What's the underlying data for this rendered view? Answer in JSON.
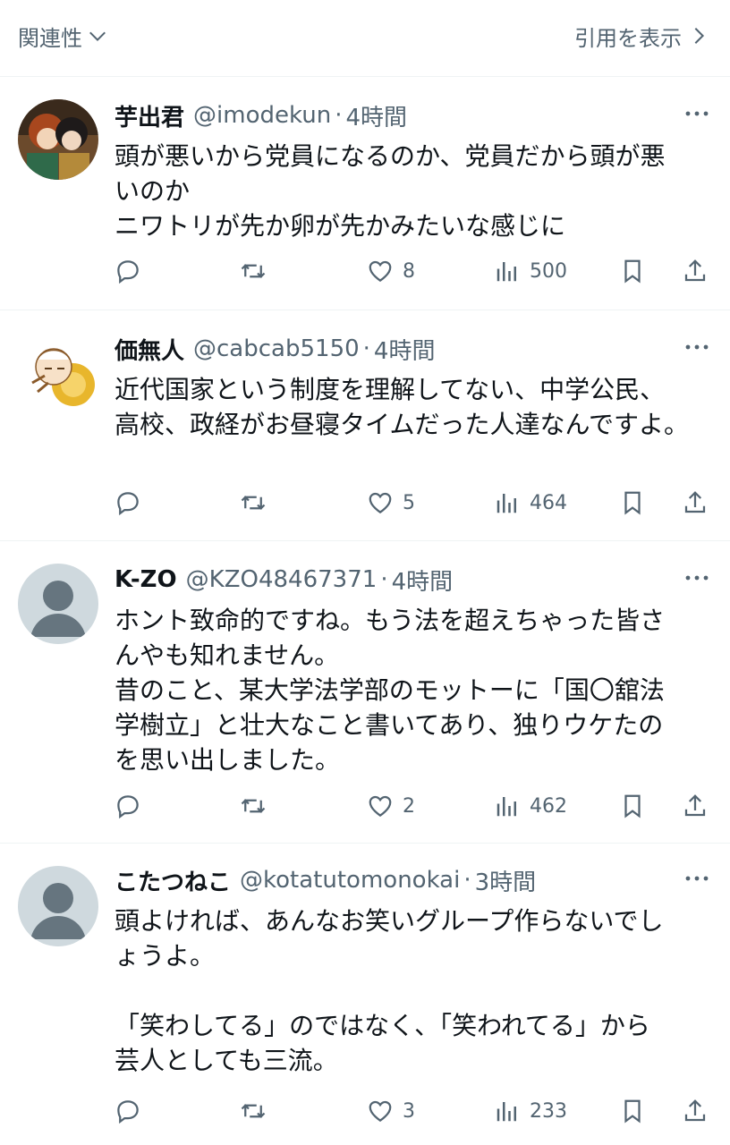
{
  "topbar": {
    "sort_label": "関連性",
    "sort_icon": "chevron-down-icon",
    "quotes_label": "引用を表示",
    "quotes_icon": "chevron-right-icon"
  },
  "tweets": [
    {
      "name": "芋出君",
      "handle": "@imodekun",
      "time": "4時間",
      "text": "頭が悪いから党員になるのか、党員だから頭が悪\nいのか\nニワトリが先か卵が先かみたいな感じに",
      "likes": "8",
      "views": "500"
    },
    {
      "name": "価無人",
      "handle": "@cabcab5150",
      "time": "4時間",
      "text": "近代国家という制度を理解してない、中学公民、\n高校、政経がお昼寝タイムだった人達なんですよ。",
      "likes": "5",
      "views": "464"
    },
    {
      "name": "K-ZO",
      "handle": "@KZO48467371",
      "time": "4時間",
      "text": "ホント致命的ですね。もう法を超えちゃった皆さ\nんやも知れません。\n昔のこと、某大学法学部のモットーに「国〇舘法\n学樹立」と壮大なこと書いてあり、独りウケたの\nを思い出しました。",
      "likes": "2",
      "views": "462"
    },
    {
      "name": "こたつねこ",
      "handle": "@kotatutomonokai",
      "time": "3時間",
      "text": "頭よければ、あんなお笑いグループ作らないでし\nょうよ。\n\n「笑わしてる」のではなく、「笑われてる」から\n芸人としても三流。",
      "likes": "3",
      "views": "233"
    }
  ],
  "separator": "·",
  "icons": {
    "reply": "reply-icon",
    "retweet": "retweet-icon",
    "like": "heart-icon",
    "views": "views-icon",
    "bookmark": "bookmark-icon",
    "share": "share-icon",
    "more": "more-icon"
  },
  "colors": {
    "secondary_text": "#536471",
    "divider": "#eff3f4",
    "default_avatar": "#cfd9de"
  }
}
